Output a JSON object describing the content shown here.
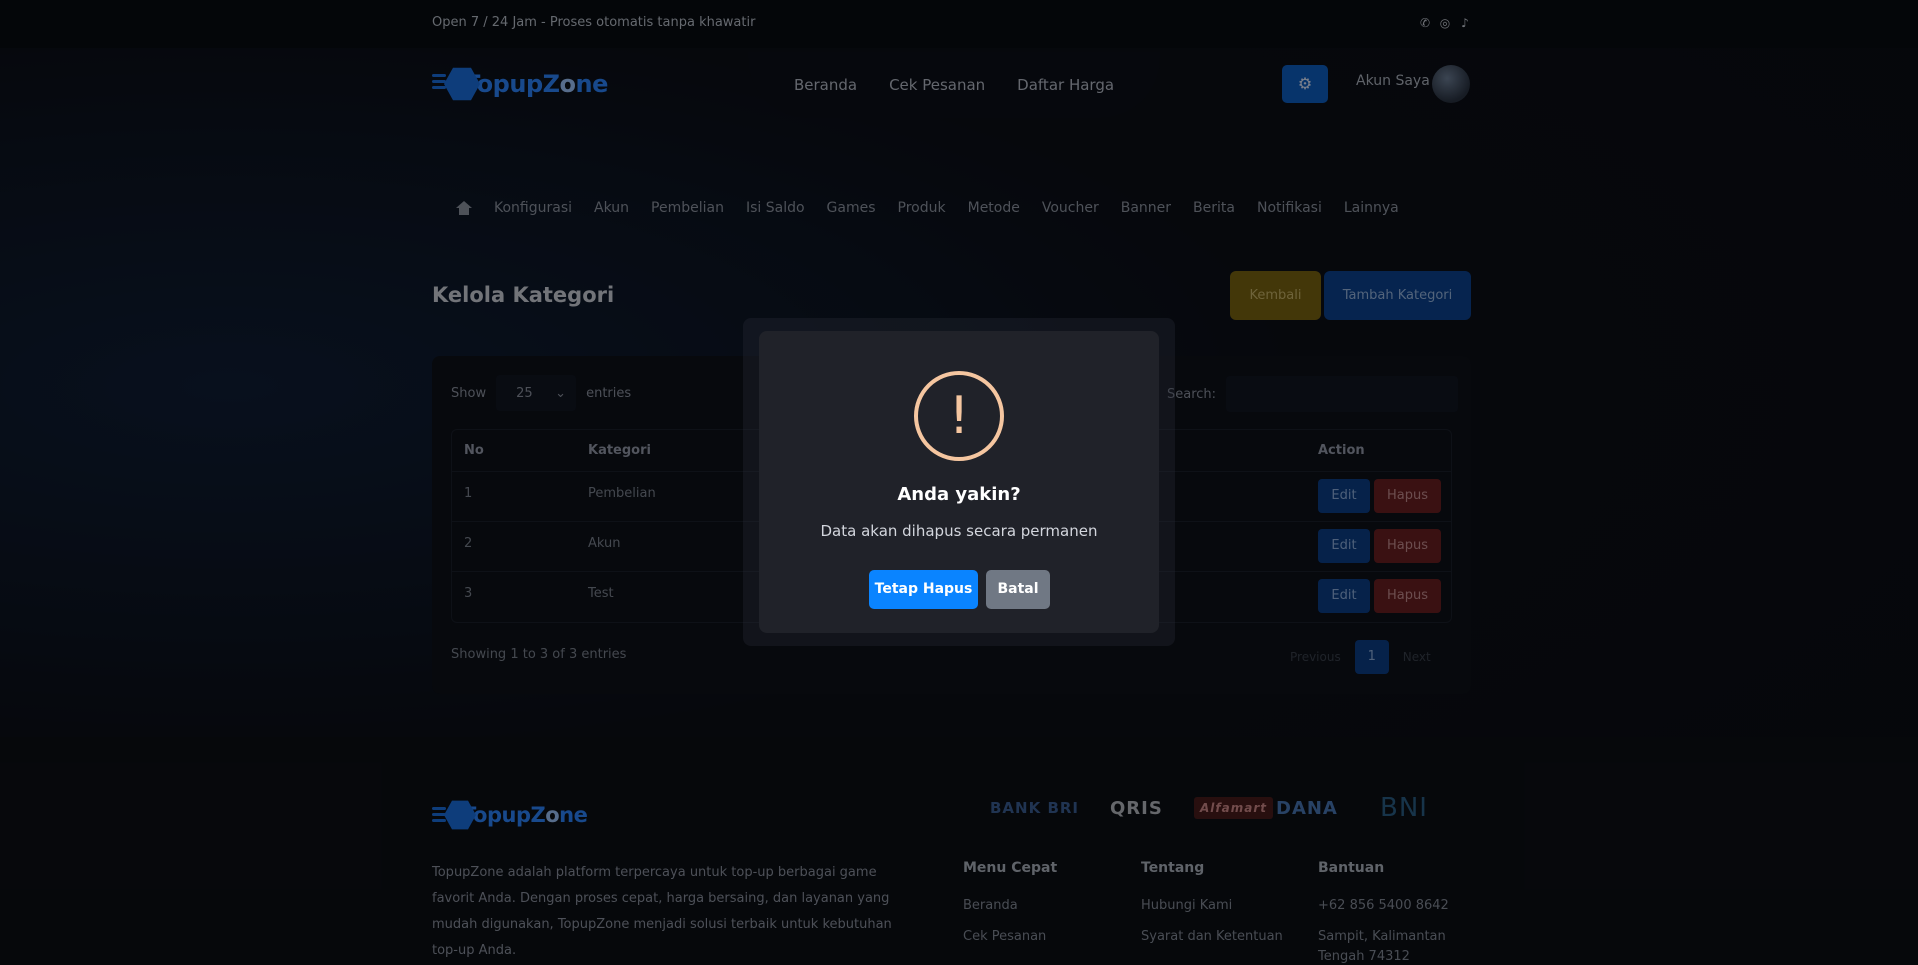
{
  "topbar": {
    "tagline": "Open 7 / 24 Jam - Proses otomatis tanpa khawatir",
    "socials": [
      "whatsapp-icon",
      "instagram-icon",
      "tiktok-icon"
    ]
  },
  "brand": {
    "part1": "TopupZ",
    "part2": "o",
    "part3": "ne"
  },
  "nav": {
    "items": [
      "Beranda",
      "Cek Pesanan",
      "Daftar Harga"
    ]
  },
  "account": {
    "label": "Akun Saya"
  },
  "admin_menu": {
    "items": [
      "Konfigurasi",
      "Akun",
      "Pembelian",
      "Isi Saldo",
      "Games",
      "Produk",
      "Metode",
      "Voucher",
      "Banner",
      "Berita",
      "Notifikasi",
      "Lainnya"
    ]
  },
  "page": {
    "title": "Kelola Kategori",
    "back_label": "Kembali",
    "add_label": "Tambah Kategori"
  },
  "table": {
    "show_label": "Show",
    "entries_value": "25",
    "entries_label": "entries",
    "search_label": "Search:",
    "columns": {
      "no": "No",
      "kategori": "Kategori",
      "action": "Action"
    },
    "rows": [
      {
        "no": "1",
        "kategori": "Pembelian"
      },
      {
        "no": "2",
        "kategori": "Akun"
      },
      {
        "no": "3",
        "kategori": "Test"
      }
    ],
    "edit_label": "Edit",
    "delete_label": "Hapus",
    "showing": "Showing 1 to 3 of 3 entries",
    "pager": {
      "prev": "Previous",
      "current": "1",
      "next": "Next"
    }
  },
  "footer": {
    "description": "TopupZone adalah platform terpercaya untuk top-up berbagai game favorit Anda. Dengan proses cepat, harga bersaing, dan layanan yang mudah digunakan, TopupZone menjadi solusi terbaik untuk kebutuhan top-up Anda.",
    "payments": [
      "BANK BRI",
      "QRIS",
      "Alfamart",
      "DANA",
      "BNI"
    ],
    "columns": {
      "menu": {
        "title": "Menu Cepat",
        "items": [
          "Beranda",
          "Cek Pesanan"
        ]
      },
      "tentang": {
        "title": "Tentang",
        "items": [
          "Hubungi Kami",
          "Syarat dan Ketentuan"
        ]
      },
      "bantuan": {
        "title": "Bantuan",
        "items": [
          "+62 856 5400 8642",
          "Sampit, Kalimantan Tengah 74312"
        ]
      }
    }
  },
  "modal": {
    "icon_glyph": "!",
    "title": "Anda yakin?",
    "message": "Data akan dihapus secara permanen",
    "confirm_label": "Tetap Hapus",
    "cancel_label": "Batal"
  },
  "colors": {
    "accent": "#0a84ff",
    "warning_icon": "#f5c6a0",
    "modal_bg": "#202229"
  }
}
